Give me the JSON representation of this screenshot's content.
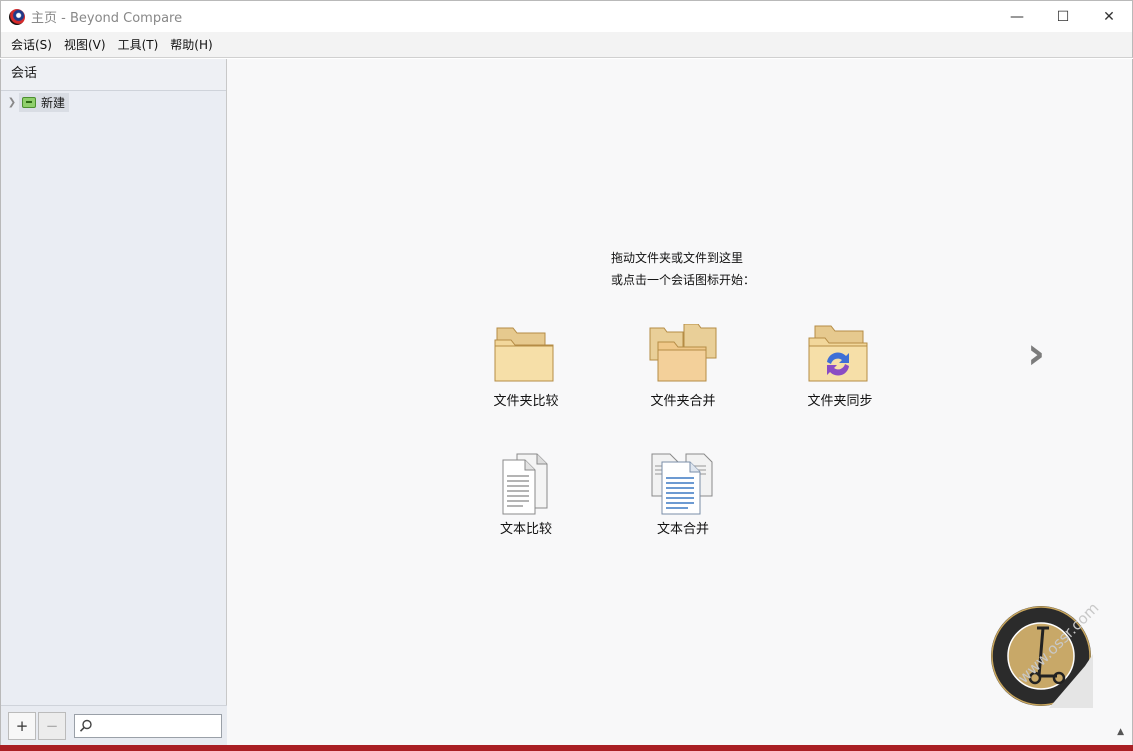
{
  "window": {
    "title": "主页 - Beyond Compare",
    "controls": {
      "minimize": "—",
      "maximize": "☐",
      "close": "✕"
    }
  },
  "menu": [
    {
      "label": "会话(S)"
    },
    {
      "label": "视图(V)"
    },
    {
      "label": "工具(T)"
    },
    {
      "label": "帮助(H)"
    }
  ],
  "sidebar": {
    "header": "会话",
    "tree": [
      {
        "label": "新建",
        "icon": "session-folder-icon"
      }
    ],
    "footer": {
      "add": "+",
      "remove": "−",
      "search_value": ""
    }
  },
  "main": {
    "instruction_line1": "拖动文件夹或文件到这里",
    "instruction_line2": "或点击一个会话图标开始：",
    "launchers": [
      {
        "label": "文件夹比较",
        "icon": "folder-compare-icon"
      },
      {
        "label": "文件夹合并",
        "icon": "folder-merge-icon"
      },
      {
        "label": "文件夹同步",
        "icon": "folder-sync-icon"
      },
      {
        "label": "文本比较",
        "icon": "text-compare-icon"
      },
      {
        "label": "文本合并",
        "icon": "text-merge-icon"
      }
    ],
    "next_arrow": "›",
    "watermark": "www.ossr.com",
    "seal_text": "SCOOTER SOFTWARE SEAL QUALITY"
  },
  "colors": {
    "accent": "#a91f24",
    "sidebar_bg": "#eaedf3",
    "main_bg": "#f8f8f9"
  }
}
